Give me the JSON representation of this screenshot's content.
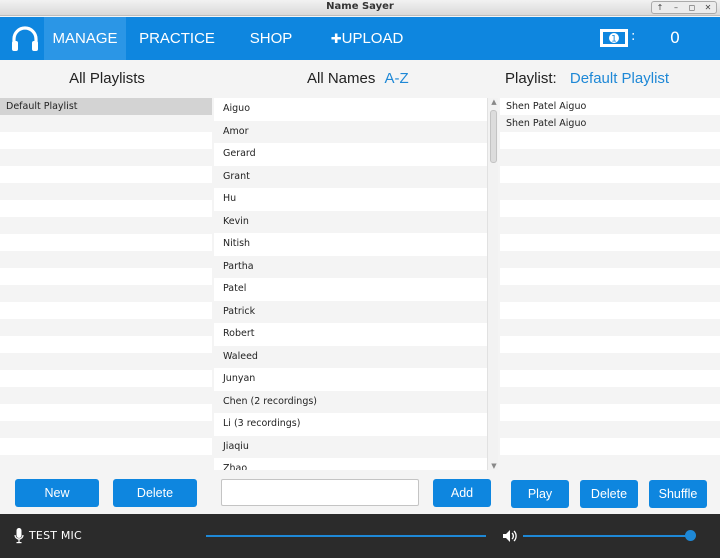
{
  "window": {
    "title": "Name Sayer",
    "controls": [
      "↑",
      "–",
      "◻",
      "✕"
    ]
  },
  "nav": {
    "tabs": [
      {
        "label": "MANAGE",
        "active": true
      },
      {
        "label": "PRACTICE",
        "active": false
      },
      {
        "label": "SHOP",
        "active": false
      },
      {
        "label": "UPLOAD",
        "prefix": "✚",
        "active": false
      }
    ],
    "money_colon": ":",
    "money_value": "0"
  },
  "playlists": {
    "heading": "All Playlists",
    "items": [
      "Default Playlist"
    ],
    "new_label": "New",
    "delete_label": "Delete"
  },
  "names": {
    "heading": "All Names",
    "sort_label": "A-Z",
    "items": [
      "Aiguo",
      "Amor",
      "Gerard",
      "Grant",
      "Hu",
      "Kevin",
      "Nitish",
      "Partha",
      "Patel",
      "Patrick",
      "Robert",
      "Waleed",
      "Junyan",
      "Chen (2 recordings)",
      "Li (3 recordings)",
      "Jiaqiu",
      "Zhao"
    ],
    "input_value": "",
    "add_label": "Add"
  },
  "playlist_view": {
    "heading": "Playlist:",
    "name": "Default Playlist",
    "items": [
      "Shen Patel Aiguo",
      "Shen Patel Aiguo"
    ],
    "play_label": "Play",
    "delete_label": "Delete",
    "shuffle_label": "Shuffle"
  },
  "footer": {
    "test_mic_label": "TEST MIC",
    "volume_level": 1.0
  },
  "colors": {
    "accent": "#0e86df",
    "footer_bg": "#2b2b2b"
  }
}
